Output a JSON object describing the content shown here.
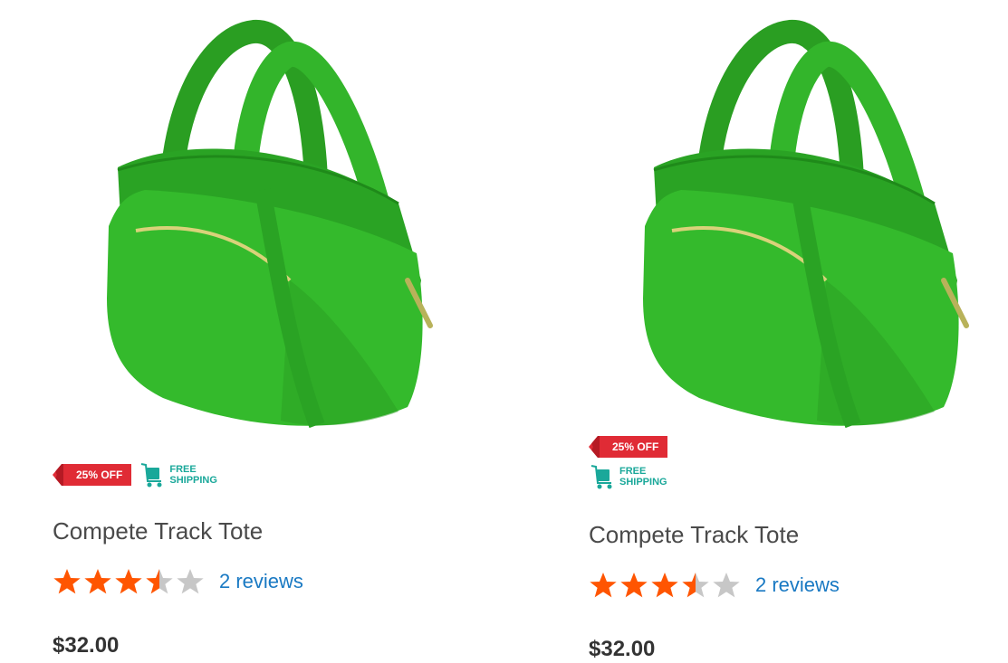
{
  "products": [
    {
      "name": "Compete Track Tote",
      "discount_label": "25% OFF",
      "shipping_label_line1": "FREE",
      "shipping_label_line2": "SHIPPING",
      "rating_stars": 3.5,
      "rating_max": 5,
      "reviews_label": "2 reviews",
      "price": "$32.00",
      "image_icon": "green-tote-bag"
    },
    {
      "name": "Compete Track Tote",
      "discount_label": "25% OFF",
      "shipping_label_line1": "FREE",
      "shipping_label_line2": "SHIPPING",
      "rating_stars": 3.5,
      "rating_max": 5,
      "reviews_label": "2 reviews",
      "price": "$32.00",
      "image_icon": "green-tote-bag"
    }
  ],
  "colors": {
    "star_filled": "#ff5501",
    "star_empty": "#c7c7c7",
    "discount_ribbon": "#e02b35",
    "shipping_text": "#1aa89a",
    "bag_green": "#2fb82a",
    "link": "#1979c3"
  }
}
